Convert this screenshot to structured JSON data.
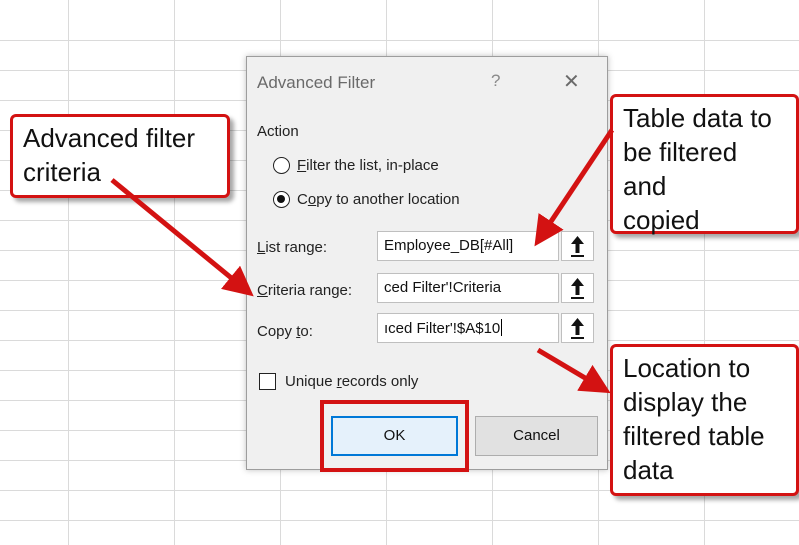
{
  "dialog": {
    "title": "Advanced Filter",
    "help_glyph": "?",
    "close_glyph": "✕",
    "action_label": "Action",
    "radio_options": [
      {
        "pre": "",
        "mnemonic": "F",
        "post": "ilter the list, in-place",
        "checked": false
      },
      {
        "pre": "C",
        "mnemonic": "o",
        "post": "py to another location",
        "checked": true
      }
    ],
    "fields": [
      {
        "label_mnemonic": "L",
        "label_rest": "ist range:",
        "value": "Employee_DB[#All]"
      },
      {
        "label_mnemonic": "C",
        "label_rest": "riteria range:",
        "value": "ced Filter'!Criteria"
      },
      {
        "label_pre": "Copy ",
        "label_mnemonic": "t",
        "label_rest": "o:",
        "value": "ıced Filter'!$A$10"
      }
    ],
    "unique_label_pre": "Unique ",
    "unique_label_mnemonic": "r",
    "unique_label_rest": "ecords only",
    "unique_checked": false,
    "ok_label": "OK",
    "cancel_label": "Cancel"
  },
  "callouts": {
    "criteria": "Advanced filter\ncriteria",
    "table": "Table data to\nbe filtered and\ncopied",
    "location": "Location to\ndisplay the\nfiltered table\ndata"
  },
  "colors": {
    "annotation_red": "#d31212",
    "ok_accent": "#0078d7",
    "dialog_bg": "#f0f0f0"
  },
  "icons": {
    "range_selector": "upload-arrow-icon"
  }
}
